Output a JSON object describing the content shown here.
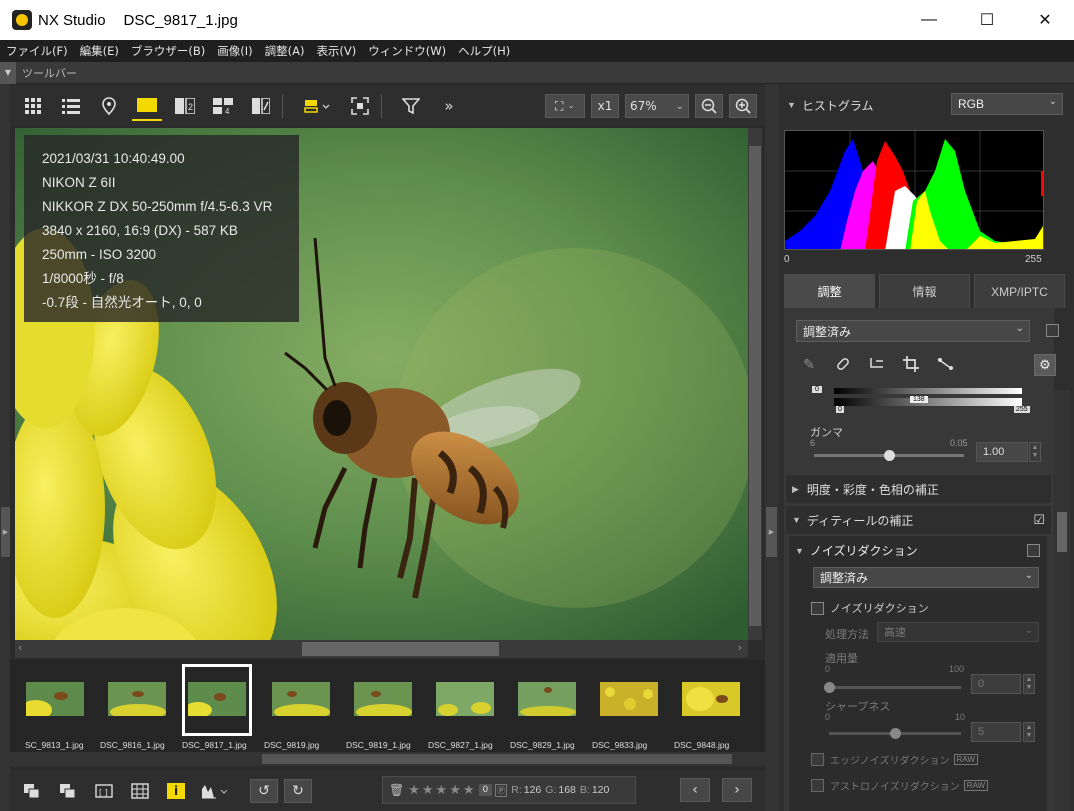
{
  "window": {
    "app_name": "NX Studio",
    "file_name": "DSC_9817_1.jpg",
    "minimize": "—",
    "maximize": "☐",
    "close": "✕"
  },
  "menu": [
    "ファイル(F)",
    "編集(E)",
    "ブラウザー(B)",
    "画像(I)",
    "調整(A)",
    "表示(V)",
    "ウィンドウ(W)",
    "ヘルプ(H)"
  ],
  "toolbar_label": "ツールバー",
  "view_toolbar": {
    "zoom_fit": "⛶",
    "zoom_x1": "x1",
    "zoom_percent": "67%"
  },
  "photo_info": {
    "datetime": "2021/03/31 10:40:49.00",
    "camera": "NIKON Z 6II",
    "lens": "NIKKOR Z DX 50-250mm f/4.5-6.3 VR",
    "dimensions": "3840 x 2160, 16:9 (DX) - 587 KB",
    "focal_iso": "250mm - ISO 3200",
    "shutter_aperture": "1/8000秒 - f/8",
    "exposure_wb": "-0.7段 - 自然光オート, 0, 0"
  },
  "filmstrip": [
    {
      "name": "SC_9813_1.jpg",
      "selected": false
    },
    {
      "name": "DSC_9816_1.jpg",
      "selected": false
    },
    {
      "name": "DSC_9817_1.jpg",
      "selected": true
    },
    {
      "name": "DSC_9819.jpg",
      "selected": false
    },
    {
      "name": "DSC_9819_1.jpg",
      "selected": false
    },
    {
      "name": "DSC_9827_1.jpg",
      "selected": false
    },
    {
      "name": "DSC_9829_1.jpg",
      "selected": false
    },
    {
      "name": "DSC_9833.jpg",
      "selected": false
    },
    {
      "name": "DSC_9848.jpg",
      "selected": false
    }
  ],
  "bottom_bar": {
    "rating_count": "0",
    "r_label": "R:",
    "r_value": "126",
    "g_label": "G:",
    "g_value": "168",
    "b_label": "B:",
    "b_value": "120",
    "prev": "‹",
    "next": "›"
  },
  "histogram": {
    "title": "ヒストグラム",
    "channel": "RGB",
    "min_label": "0",
    "max_label": "255"
  },
  "tabs": [
    "調整",
    "情報",
    "XMP/IPTC"
  ],
  "adjust": {
    "preset": "調整済み",
    "levels_black": "0",
    "levels_mid": "138",
    "levels_out_black": "0",
    "levels_out_white": "255",
    "gamma_label": "ガンマ",
    "gamma_min": "6",
    "gamma_max": "0.05",
    "gamma_value": "1.00",
    "brightness_section": "明度・彩度・色相の補正",
    "detail_section": "ディティールの補正",
    "noise_section": "ノイズリダクション",
    "noise_preset": "調整済み",
    "noise_checkbox_label": "ノイズリダクション",
    "method_label": "処理方法",
    "method_value": "高速",
    "amount_label": "適用量",
    "amount_min": "0",
    "amount_max": "100",
    "amount_value": "0",
    "sharpness_label": "シャープネス",
    "sharp_min": "0",
    "sharp_max": "10",
    "sharp_value": "5",
    "edge_nr": "エッジノイズリダクション",
    "astro_nr": "アストロノイズリダクション",
    "raw_badge": "RAW"
  },
  "colors": {
    "accent_yellow": "#f3d900",
    "panel_bg": "#2e2e2e",
    "background_green": "#5e9050"
  }
}
